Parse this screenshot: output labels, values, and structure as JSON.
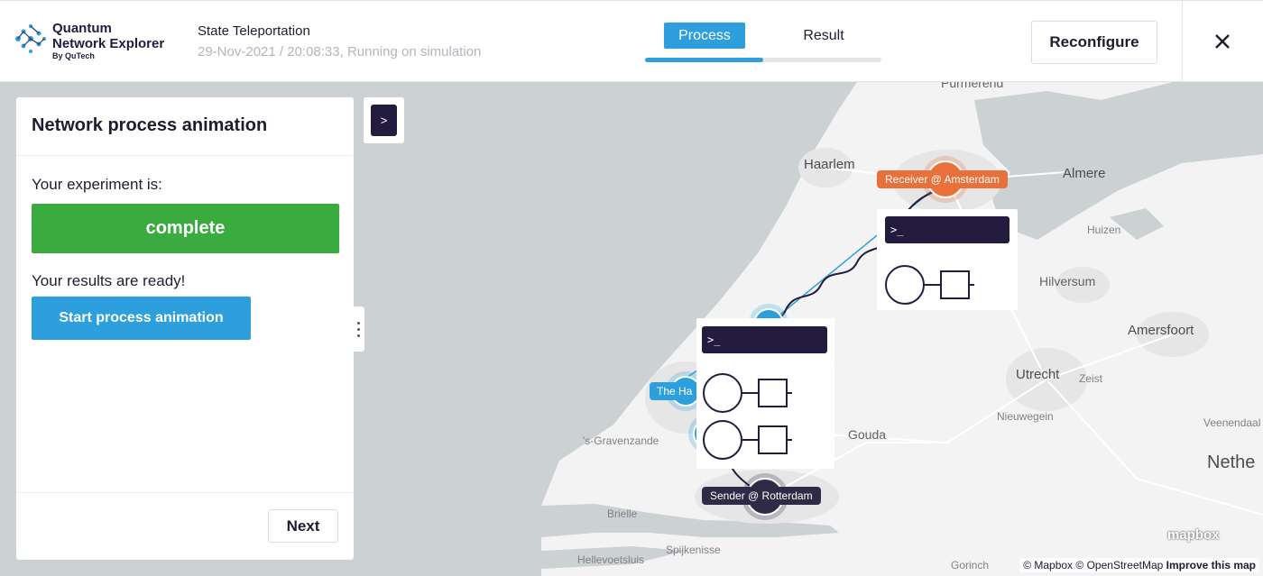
{
  "header": {
    "logo": {
      "line1": "Quantum",
      "line2": "Network Explorer",
      "line3": "By QuTech"
    },
    "experiment_title": "State Teleportation",
    "experiment_subtitle": "29-Nov-2021 / 20:08:33, Running on simulation",
    "tabs": [
      {
        "label": "Process",
        "active": true
      },
      {
        "label": "Result",
        "active": false
      }
    ],
    "progress_fraction": 0.5,
    "reconfigure_label": "Reconfigure",
    "close_icon": "close-icon"
  },
  "panel": {
    "title": "Network process animation",
    "experiment_is_label": "Your experiment is:",
    "status_label": "complete",
    "results_ready_label": "Your results are ready!",
    "start_button_label": "Start process animation",
    "next_button_label": "Next"
  },
  "map": {
    "toggle_label": ">",
    "places": {
      "purmerend": "Purmerend",
      "haarlem": "Haarlem",
      "almere": "Almere",
      "huizen": "Huizen",
      "hilversum": "Hilversum",
      "amersfoort": "Amersfoort",
      "utrecht": "Utrecht",
      "zeist": "Zeist",
      "nieuwegein": "Nieuwegein",
      "veenendaal": "Veenendaal",
      "gouda": "Gouda",
      "gravenzande": "'s-Gravenzande",
      "brielle": "Brielle",
      "spijkenisse": "Spijkenisse",
      "hellevoetsluis": "Hellevoetsluis",
      "gorinchem": "Gorinch",
      "nether": "Nethe"
    },
    "nodes": {
      "receiver": "Receiver @ Amsterdam",
      "sender": "Sender @ Rotterdam",
      "hague": "The Ha"
    },
    "terminal_prompt": ">_",
    "attribution": {
      "mapbox": "© Mapbox",
      "osm": "© OpenStreetMap",
      "improve": "Improve this map"
    },
    "mapbox_logo": "mapbox",
    "colors": {
      "receiver": "#e8703a",
      "sender": "#2f2b46",
      "hague": "#2d9fdc",
      "link": "#2d9fdc"
    }
  }
}
